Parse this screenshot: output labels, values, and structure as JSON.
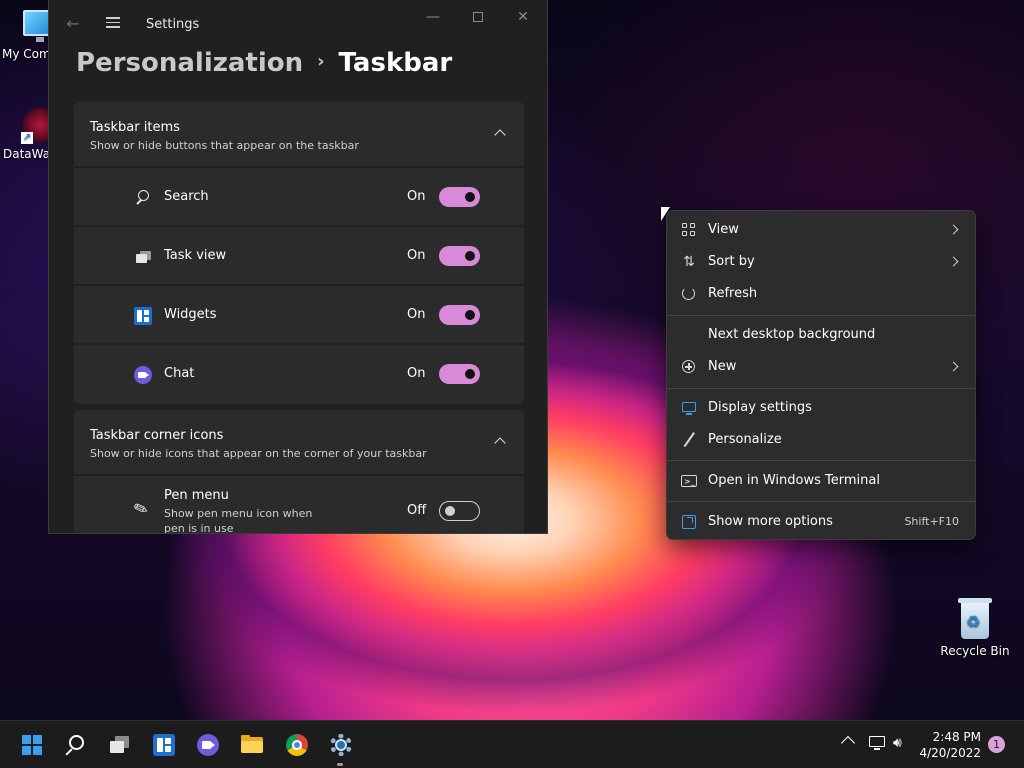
{
  "desktop": {
    "icons": [
      {
        "label": "My Com",
        "icon": "computer-icon"
      },
      {
        "label": "DataWag",
        "icon": "datawag-app-icon"
      },
      {
        "label": "Recycle Bin",
        "icon": "recycle-bin-icon"
      }
    ]
  },
  "settings": {
    "window_title": "Settings",
    "breadcrumb": {
      "parent": "Personalization",
      "separator": "›",
      "current": "Taskbar"
    },
    "taskbar_items": {
      "title": "Taskbar items",
      "subtitle": "Show or hide buttons that appear on the taskbar",
      "rows": [
        {
          "label": "Search",
          "state": "On",
          "on": true,
          "icon": "search-icon"
        },
        {
          "label": "Task view",
          "state": "On",
          "on": true,
          "icon": "task-view-icon"
        },
        {
          "label": "Widgets",
          "state": "On",
          "on": true,
          "icon": "widgets-icon"
        },
        {
          "label": "Chat",
          "state": "On",
          "on": true,
          "icon": "chat-icon"
        }
      ]
    },
    "corner_icons": {
      "title": "Taskbar corner icons",
      "subtitle": "Show or hide icons that appear on the corner of your taskbar",
      "pen": {
        "label": "Pen menu",
        "description": "Show pen menu icon when pen is in use",
        "state": "Off",
        "on": false,
        "icon": "pen-icon"
      }
    },
    "toggle_on_color": "#d88ad8"
  },
  "context_menu": {
    "items": [
      {
        "label": "View",
        "icon": "grid-view-icon",
        "submenu": true
      },
      {
        "label": "Sort by",
        "icon": "sort-icon",
        "submenu": true
      },
      {
        "label": "Refresh",
        "icon": "refresh-icon",
        "submenu": false
      },
      {
        "label": "Next desktop background",
        "icon": "",
        "submenu": false
      },
      {
        "label": "New",
        "icon": "add-circle-icon",
        "submenu": true
      },
      {
        "label": "Display settings",
        "icon": "display-icon",
        "submenu": false
      },
      {
        "label": "Personalize",
        "icon": "brush-icon",
        "submenu": false
      },
      {
        "label": "Open in Windows Terminal",
        "icon": "terminal-icon",
        "submenu": false
      },
      {
        "label": "Show more options",
        "icon": "more-options-icon",
        "submenu": false,
        "shortcut": "Shift+F10"
      }
    ]
  },
  "taskbar": {
    "apps": [
      {
        "name": "Start",
        "icon": "windows-start-icon"
      },
      {
        "name": "Search",
        "icon": "search-icon"
      },
      {
        "name": "Task View",
        "icon": "task-view-icon"
      },
      {
        "name": "Widgets",
        "icon": "widgets-icon"
      },
      {
        "name": "Chat",
        "icon": "chat-icon"
      },
      {
        "name": "File Explorer",
        "icon": "folder-icon"
      },
      {
        "name": "Google Chrome",
        "icon": "chrome-icon"
      },
      {
        "name": "Settings",
        "icon": "settings-gear-icon",
        "active": true
      }
    ],
    "tray": {
      "time": "2:48 PM",
      "date": "4/20/2022",
      "notification_count": "1"
    },
    "accent": "#3aa0f2"
  }
}
